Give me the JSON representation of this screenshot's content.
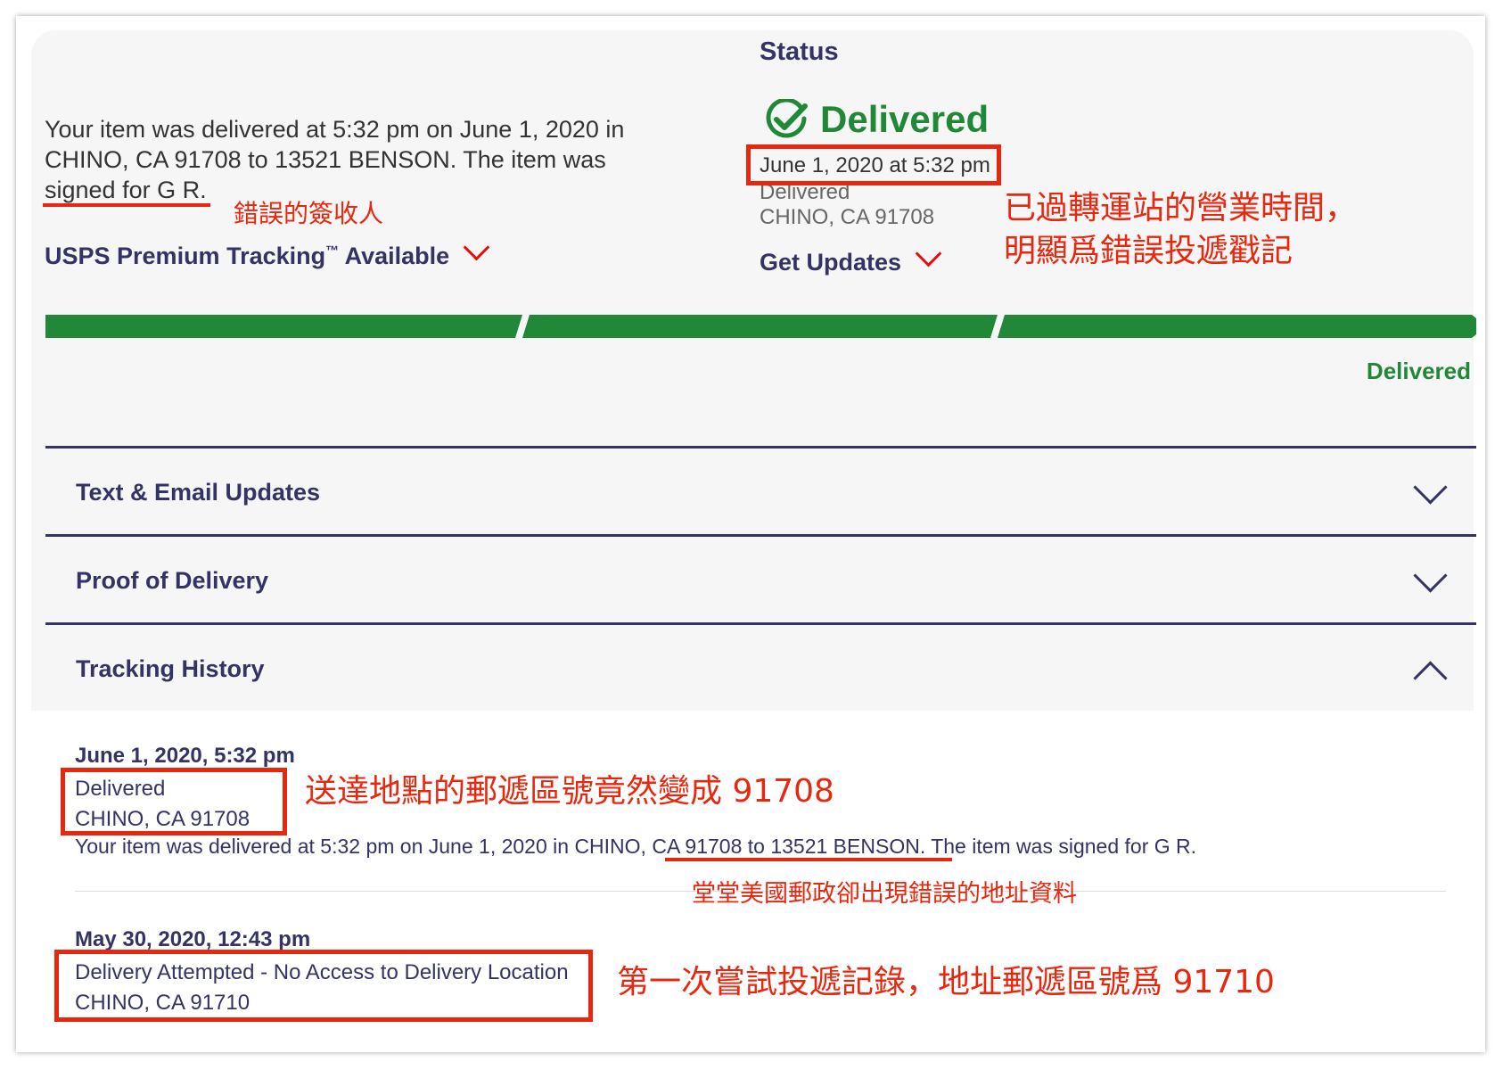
{
  "summary": {
    "line1": "Your item was delivered at 5:32 pm on June 1, 2020 in",
    "line2": "CHINO, CA 91708 to 13521 BENSON. The item was",
    "line3": "signed for G R."
  },
  "premium_tracking": {
    "label": "USPS Premium Tracking",
    "tm": "™",
    "suffix": " Available"
  },
  "status": {
    "title": "Status",
    "state": "Delivered",
    "datetime": "June 1, 2020 at 5:32 pm",
    "event": "Delivered",
    "location": "CHINO, CA 91708",
    "get_updates": "Get Updates"
  },
  "progress": {
    "segments": 3,
    "completed": 3,
    "label": "Delivered"
  },
  "accordions": [
    {
      "label": "Text & Email Updates",
      "expanded": false
    },
    {
      "label": "Proof of Delivery",
      "expanded": false
    },
    {
      "label": "Tracking History",
      "expanded": true
    }
  ],
  "history": [
    {
      "date": "June 1, 2020, 5:32 pm",
      "event": "Delivered",
      "location": "CHINO, CA 91708",
      "desc_pre": "Your item was delivered at 5:32 pm on June 1, 2020 in CHINO, ",
      "desc_addr": "CA 91708 to 13521 BENSON",
      "desc_post": ". The item was signed for G R."
    },
    {
      "date": "May 30, 2020, 12:43 pm",
      "event": "Delivery Attempted - No Access to Delivery Location",
      "location": "CHINO, CA 91710"
    }
  ],
  "annotations": {
    "wrong_signer": "錯誤的簽收人",
    "hours_line1": "已過轉運站的營業時間，",
    "hours_line2": "明顯爲錯誤投遞戳記",
    "zip_changed": "送達地點的郵遞區號竟然變成 91708",
    "wrong_address": "堂堂美國郵政卻出現錯誤的地址資料",
    "first_attempt": "第一次嘗試投遞記錄，地址郵遞區號爲 91710"
  },
  "colors": {
    "navy": "#333366",
    "green": "#218838",
    "annotation_red": "#e8270f"
  }
}
